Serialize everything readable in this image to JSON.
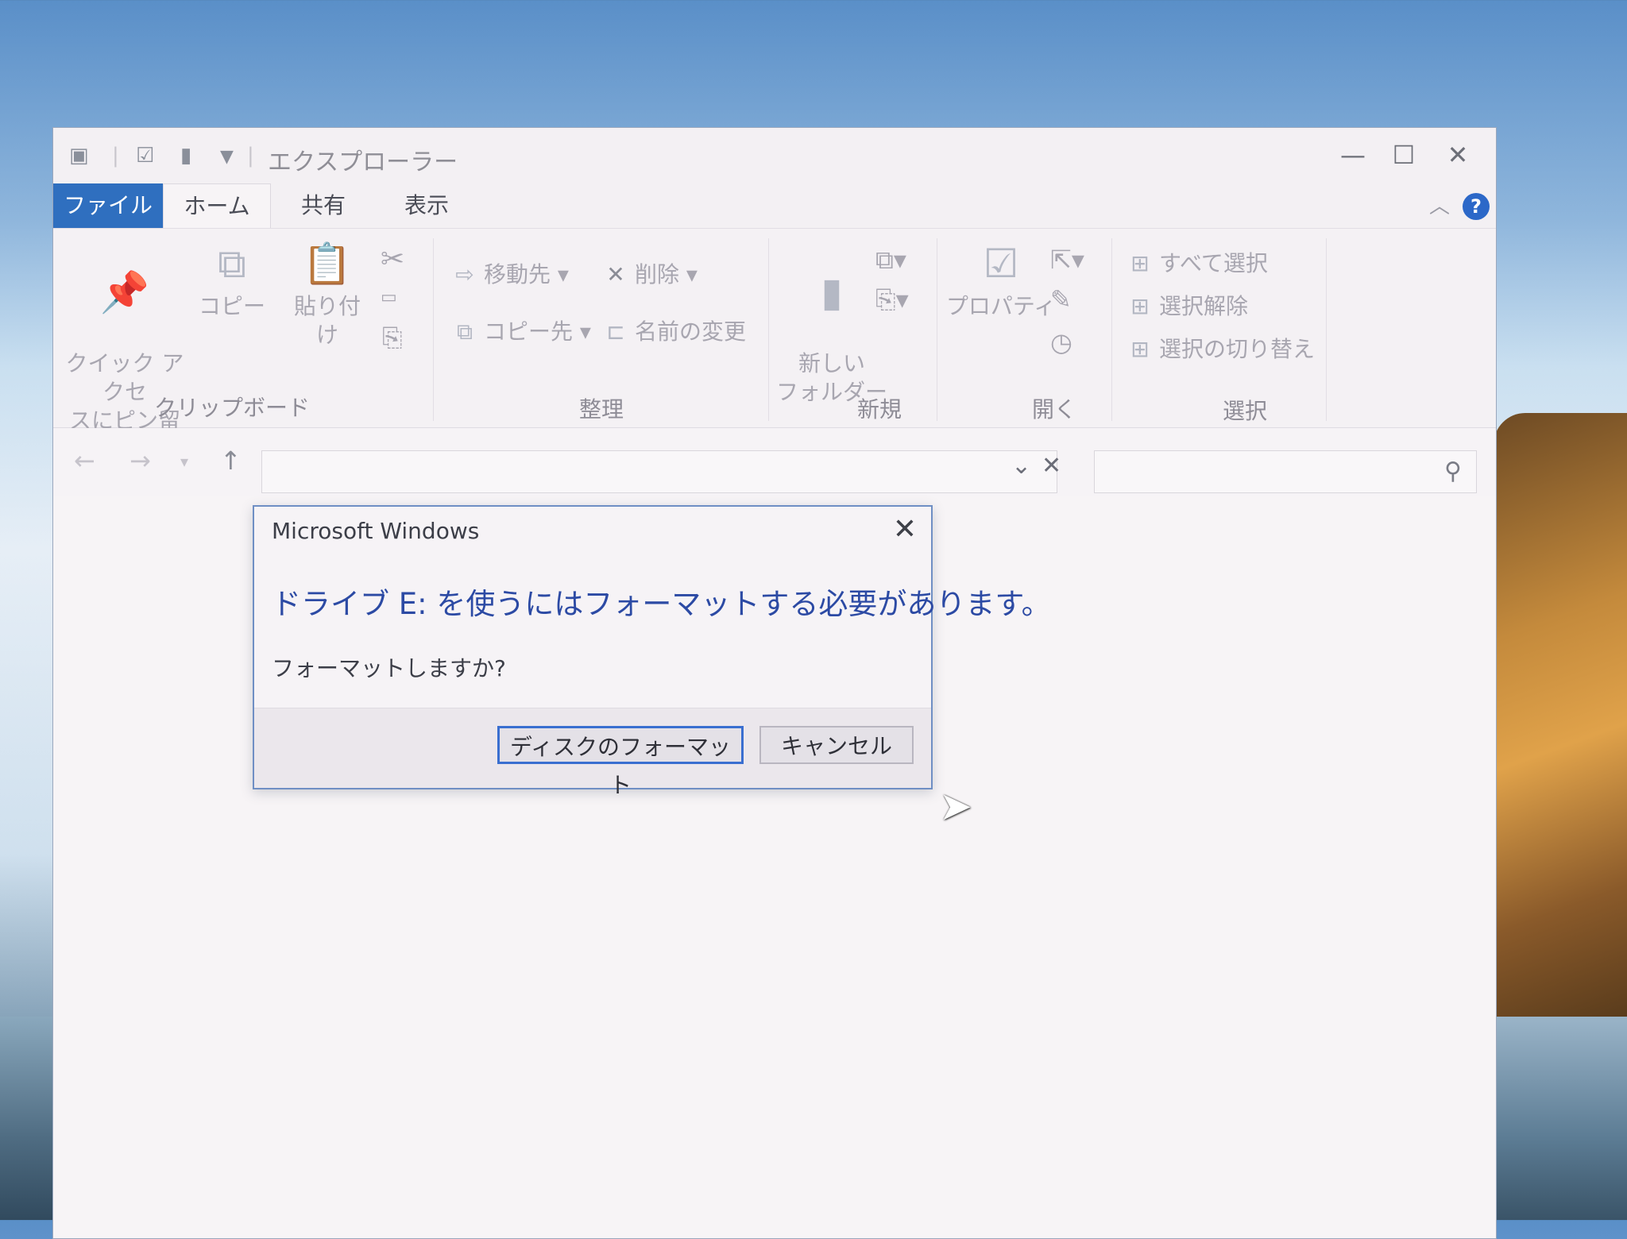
{
  "window": {
    "title": "エクスプローラー",
    "tabs": {
      "file": "ファイル",
      "home": "ホーム",
      "share": "共有",
      "view": "表示"
    },
    "help": "?"
  },
  "ribbon": {
    "clipboard": {
      "pin": "クイック アクセ\nスにピン留め",
      "copy": "コピー",
      "paste": "貼り付け",
      "label": "クリップボード"
    },
    "organize": {
      "move_to": "移動先",
      "delete": "削除",
      "copy_to": "コピー先",
      "rename": "名前の変更",
      "label": "整理"
    },
    "new": {
      "new_folder": "新しい\nフォルダー",
      "label": "新規"
    },
    "open": {
      "properties": "プロパティ",
      "label": "開く"
    },
    "select": {
      "select_all": "すべて選択",
      "select_none": "選択解除",
      "invert": "選択の切り替え",
      "label": "選択"
    }
  },
  "dialog": {
    "title": "Microsoft Windows",
    "message": "ドライブ E: を使うにはフォーマットする必要があります。",
    "question": "フォーマットしますか?",
    "primary_button": "ディスクのフォーマット",
    "cancel_button": "キャンセル"
  },
  "colors": {
    "accent": "#2f6fbf",
    "dialog_message": "#2c4aa4",
    "primary_border": "#3a6fd0"
  }
}
